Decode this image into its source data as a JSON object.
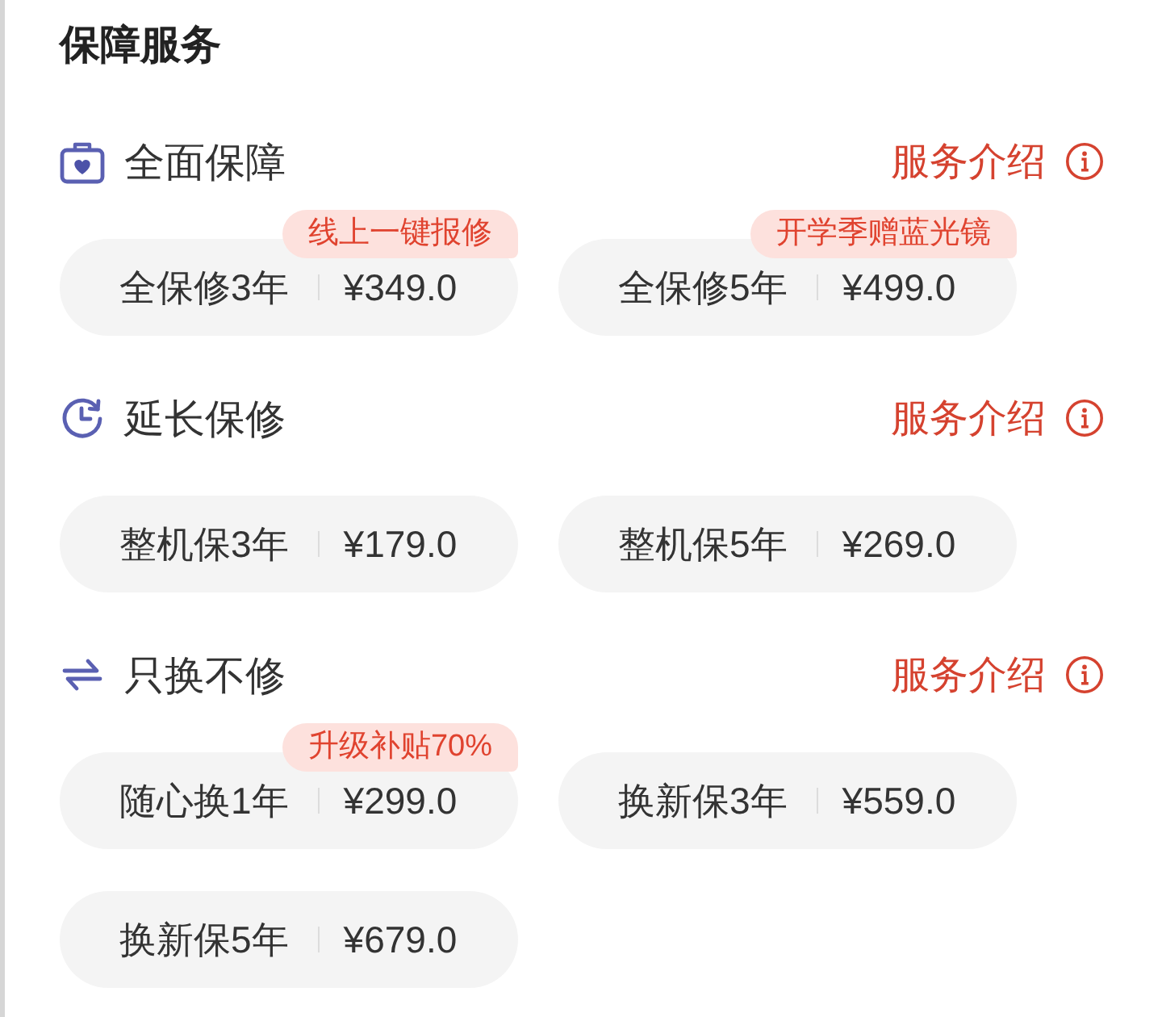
{
  "title": "保障服务",
  "sections": [
    {
      "kind": "case",
      "title": "全面保障",
      "link": "服务介绍",
      "options": [
        {
          "name": "全保修3年",
          "price": "¥349.0",
          "badge": "线上一键报修",
          "selected": false
        },
        {
          "name": "全保修5年",
          "price": "¥499.0",
          "badge": "开学季赠蓝光镜",
          "selected": false
        }
      ]
    },
    {
      "kind": "clock",
      "title": "延长保修",
      "link": "服务介绍",
      "options": [
        {
          "name": "整机保3年",
          "price": "¥179.0",
          "selected": false
        },
        {
          "name": "整机保5年",
          "price": "¥269.0",
          "selected": false
        }
      ]
    },
    {
      "kind": "swap",
      "title": "只换不修",
      "link": "服务介绍",
      "options": [
        {
          "name": "随心换1年",
          "price": "¥299.0",
          "badge": "升级补贴70%",
          "selected": false
        },
        {
          "name": "换新保3年",
          "price": "¥559.0",
          "selected": false
        },
        {
          "name": "换新保5年",
          "price": "¥679.0",
          "selected": false
        }
      ]
    }
  ]
}
